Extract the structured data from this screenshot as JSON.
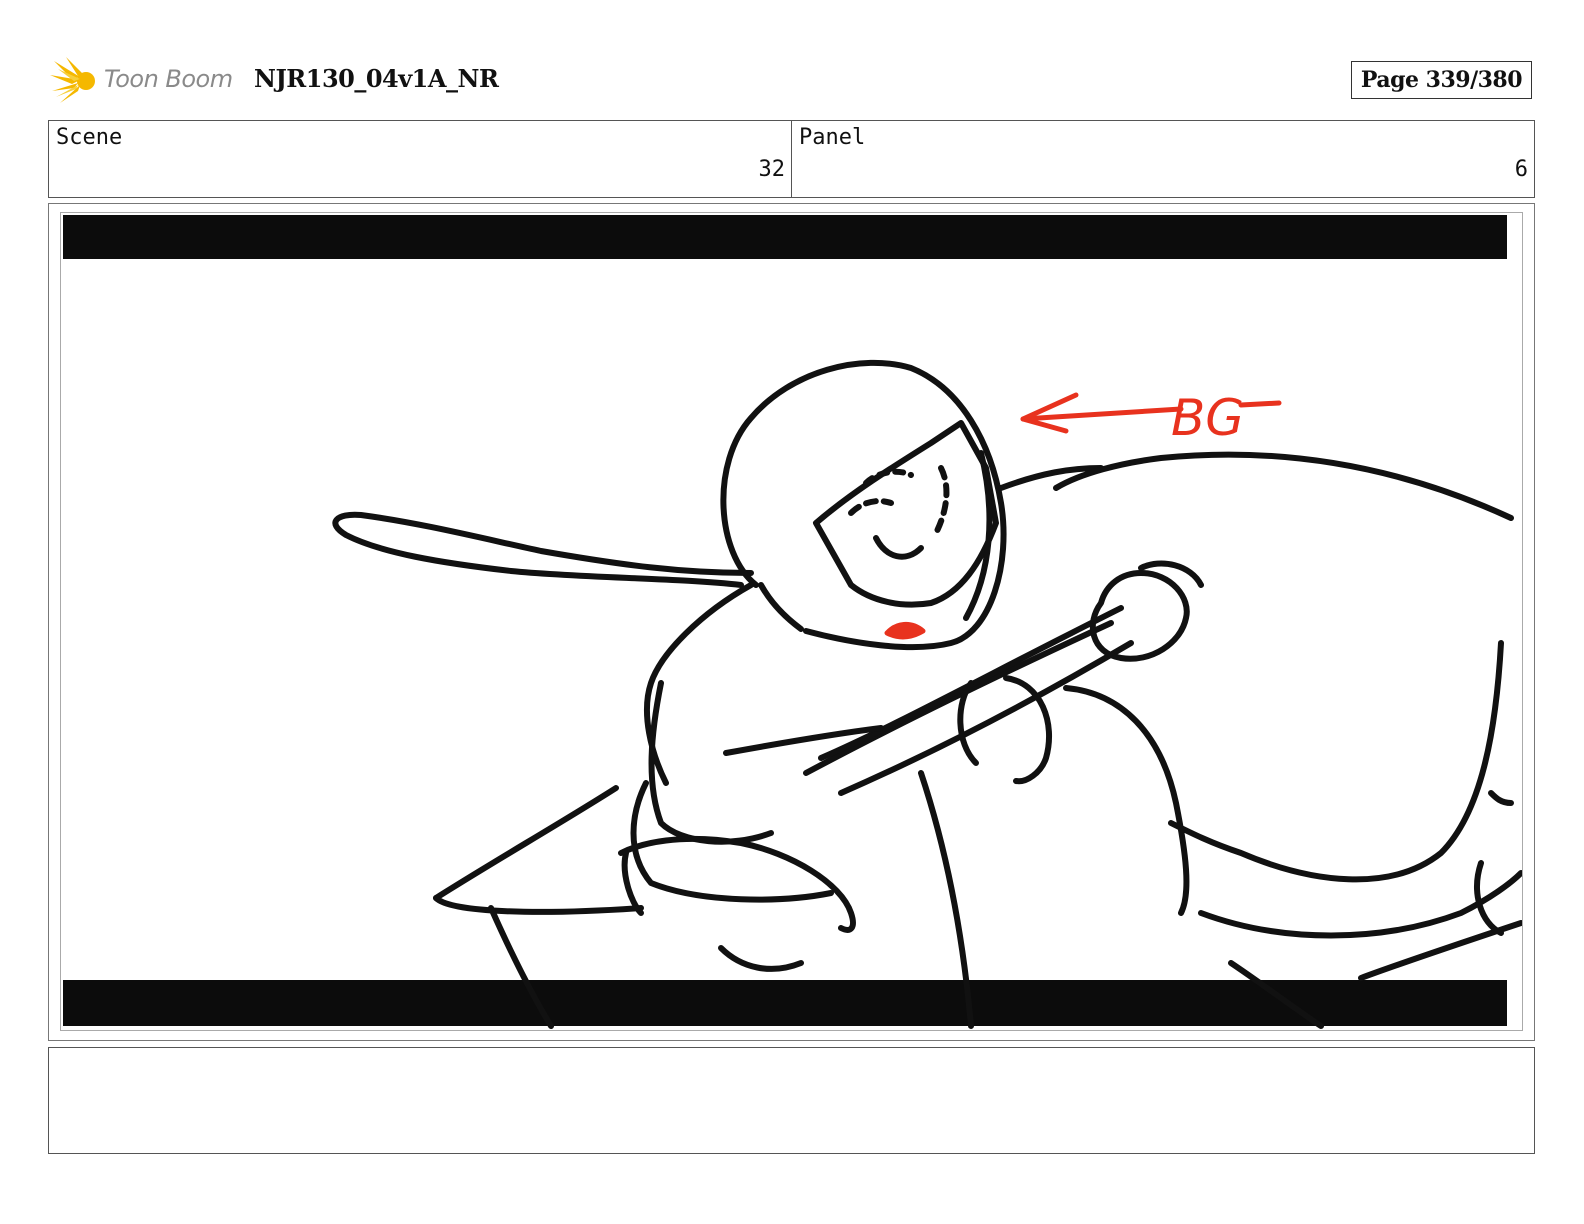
{
  "header": {
    "logo_text": "Toon Boom",
    "project_title": "NJR130_04v1A_NR",
    "page_label": "Page 339/380"
  },
  "info": {
    "scene_label": "Scene",
    "scene_value": "32",
    "panel_label": "Panel",
    "panel_value": "6"
  },
  "panel": {
    "annotation_text": "BG",
    "annotation_color": "#e8321e",
    "stroke_color": "#111111"
  },
  "notes": {
    "text": ""
  }
}
